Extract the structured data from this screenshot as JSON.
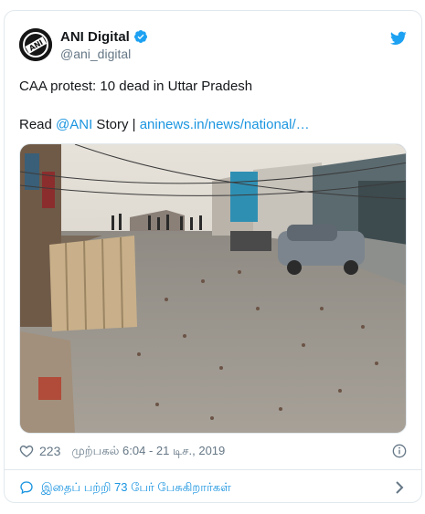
{
  "tweet": {
    "display_name": "ANI Digital",
    "handle": "@ani_digital",
    "avatar_text": "ANI",
    "text_line1": "CAA protest: 10 dead in Uttar Pradesh",
    "read_prefix": "Read ",
    "mention": "@ANI",
    "story_text": " Story | ",
    "link_text": "aninews.in/news/national/…",
    "likes": "223",
    "timestamp": "முற்பகல் 6:04 - 21 டிச., 2019",
    "footer_text": "இதைப் பற்றி 73 பேர் பேசுகிறார்கள்"
  },
  "colors": {
    "link": "#1b95e0",
    "muted": "#657786",
    "border": "#e1e8ed"
  },
  "icons": [
    "verified-badge-icon",
    "twitter-bird-icon",
    "heart-icon",
    "info-icon",
    "comment-icon",
    "chevron-right-icon"
  ]
}
